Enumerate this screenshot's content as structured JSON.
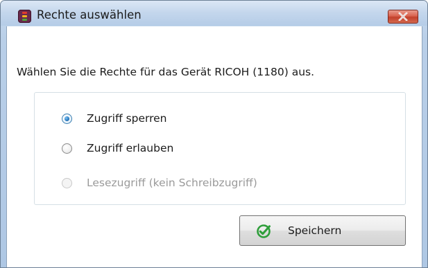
{
  "window": {
    "title": "Rechte auswählen",
    "close_symbol": "×"
  },
  "dialog": {
    "prompt": "Wählen Sie die Rechte für das Gerät RICOH (1180) aus.",
    "options": [
      {
        "label": "Zugriff sperren",
        "selected": true,
        "enabled": true
      },
      {
        "label": "Zugriff erlauben",
        "selected": false,
        "enabled": true
      },
      {
        "label": "Lesezugriff (kein Schreibzugriff)",
        "selected": false,
        "enabled": false
      }
    ],
    "save_label": "Speichern"
  },
  "colors": {
    "accent": "#2b7cc1",
    "check_green": "#2e9e3a",
    "close_red": "#c2402b"
  },
  "icons": {
    "app": "traffic-light-app-icon",
    "close": "close-icon",
    "save": "checkmark-circle-icon"
  }
}
